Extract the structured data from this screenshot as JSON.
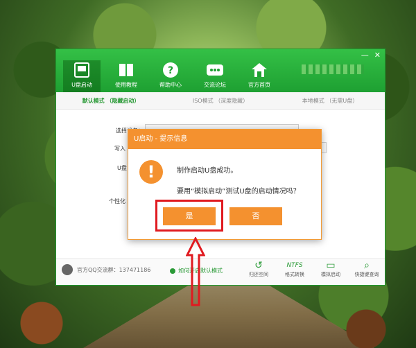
{
  "titlebar": {
    "nav": [
      {
        "label": "U盘启动",
        "icon": "usb-drive-icon",
        "active": true
      },
      {
        "label": "使用教程",
        "icon": "book-icon",
        "active": false
      },
      {
        "label": "帮助中心",
        "icon": "question-icon",
        "active": false
      },
      {
        "label": "交流论坛",
        "icon": "chat-icon",
        "active": false
      },
      {
        "label": "官方首页",
        "icon": "home-icon",
        "active": false
      }
    ]
  },
  "tabs": [
    {
      "label": "默认模式 （隐藏启动）",
      "active": true
    },
    {
      "label": "ISO模式 （深度隐藏）",
      "active": false
    },
    {
      "label": "本地模式 （无需U盘）",
      "active": false
    }
  ],
  "form": {
    "device_label": "选择设备：",
    "write_label": "写入",
    "u_label": "U盘",
    "custom_label": "个性化"
  },
  "footer": {
    "qq": "官方QQ交流群：137471186",
    "how": "如何开启默认模式",
    "tools": [
      {
        "label": "归还空间",
        "icon": "restore-icon"
      },
      {
        "label": "格式转换",
        "icon": "ntfs-icon"
      },
      {
        "label": "模拟启动",
        "icon": "monitor-icon"
      },
      {
        "label": "快捷键查询",
        "icon": "search-icon"
      }
    ]
  },
  "dialog": {
    "title": "U启动 - 提示信息",
    "line1": "制作启动U盘成功。",
    "line2": "要用“模拟启动”测试U盘的启动情况吗？",
    "yes": "是",
    "no": "否"
  },
  "colors": {
    "green": "#1ea032",
    "orange": "#f4912f",
    "highlight": "#e01a20"
  }
}
